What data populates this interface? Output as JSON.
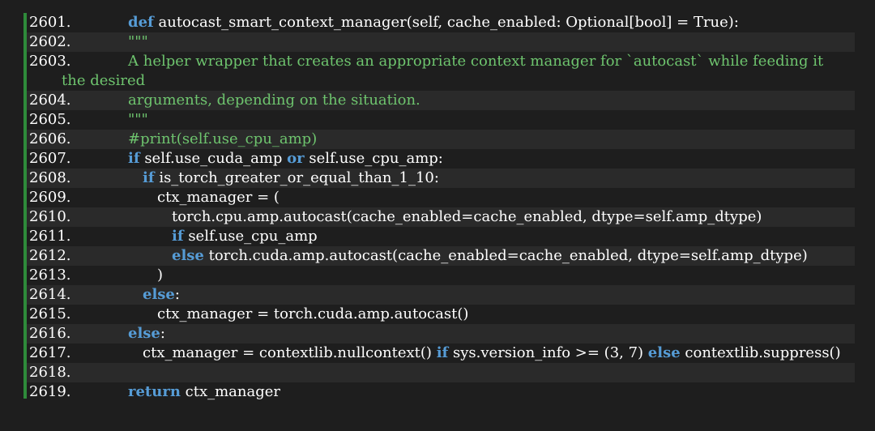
{
  "editor": {
    "accent": "#2e8b3a",
    "lines": [
      {
        "num": "2601.",
        "indent": 1,
        "tokens": [
          {
            "t": "def",
            "k": "kw"
          },
          {
            "t": " autocast_smart_context_manager(self, cache_enabled: Optional[bool] = True):",
            "k": ""
          }
        ]
      },
      {
        "num": "2602.",
        "indent": 1,
        "tokens": [
          {
            "t": "\"\"\"",
            "k": "doc"
          }
        ]
      },
      {
        "num": "2603.",
        "indent": 1,
        "wrap": "the desired",
        "tokens": [
          {
            "t": "A helper wrapper that creates an appropriate context manager for `autocast` while feeding it",
            "k": "doc"
          }
        ]
      },
      {
        "num": "2604.",
        "indent": 1,
        "tokens": [
          {
            "t": "arguments, depending on the situation.",
            "k": "doc"
          }
        ]
      },
      {
        "num": "2605.",
        "indent": 1,
        "tokens": [
          {
            "t": "\"\"\"",
            "k": "doc"
          }
        ]
      },
      {
        "num": "2606.",
        "indent": 1,
        "tokens": [
          {
            "t": "#print(self.use_cpu_amp)",
            "k": "cmt"
          }
        ]
      },
      {
        "num": "2607.",
        "indent": 1,
        "tokens": [
          {
            "t": "if",
            "k": "kw"
          },
          {
            "t": " self.use_cuda_amp ",
            "k": ""
          },
          {
            "t": "or",
            "k": "kw"
          },
          {
            "t": " self.use_cpu_amp:",
            "k": ""
          }
        ]
      },
      {
        "num": "2608.",
        "indent": 2,
        "tokens": [
          {
            "t": "if",
            "k": "kw"
          },
          {
            "t": " is_torch_greater_or_equal_than_1_10:",
            "k": ""
          }
        ]
      },
      {
        "num": "2609.",
        "indent": 3,
        "tokens": [
          {
            "t": "ctx_manager = (",
            "k": ""
          }
        ]
      },
      {
        "num": "2610.",
        "indent": 4,
        "tokens": [
          {
            "t": "torch.cpu.amp.autocast(cache_enabled=cache_enabled, dtype=self.amp_dtype)",
            "k": ""
          }
        ]
      },
      {
        "num": "2611.",
        "indent": 4,
        "tokens": [
          {
            "t": "if",
            "k": "kw"
          },
          {
            "t": " self.use_cpu_amp",
            "k": ""
          }
        ]
      },
      {
        "num": "2612.",
        "indent": 4,
        "tokens": [
          {
            "t": "else",
            "k": "kw"
          },
          {
            "t": " torch.cuda.amp.autocast(cache_enabled=cache_enabled, dtype=self.amp_dtype)",
            "k": ""
          }
        ]
      },
      {
        "num": "2613.",
        "indent": 3,
        "tokens": [
          {
            "t": ")",
            "k": ""
          }
        ]
      },
      {
        "num": "2614.",
        "indent": 2,
        "tokens": [
          {
            "t": "else",
            "k": "kw"
          },
          {
            "t": ":",
            "k": ""
          }
        ]
      },
      {
        "num": "2615.",
        "indent": 3,
        "tokens": [
          {
            "t": "ctx_manager = torch.cuda.amp.autocast()",
            "k": ""
          }
        ]
      },
      {
        "num": "2616.",
        "indent": 1,
        "tokens": [
          {
            "t": "else",
            "k": "kw"
          },
          {
            "t": ":",
            "k": ""
          }
        ]
      },
      {
        "num": "2617.",
        "indent": 2,
        "tokens": [
          {
            "t": "ctx_manager = contextlib.nullcontext() ",
            "k": ""
          },
          {
            "t": "if",
            "k": "kw"
          },
          {
            "t": " sys.version_info >= (3, 7) ",
            "k": ""
          },
          {
            "t": "else",
            "k": "kw"
          },
          {
            "t": " contextlib.suppress()",
            "k": ""
          }
        ]
      },
      {
        "num": "2618.",
        "indent": 0,
        "tokens": []
      },
      {
        "num": "2619.",
        "indent": 1,
        "tokens": [
          {
            "t": "return",
            "k": "kw"
          },
          {
            "t": " ctx_manager",
            "k": ""
          }
        ]
      }
    ]
  }
}
